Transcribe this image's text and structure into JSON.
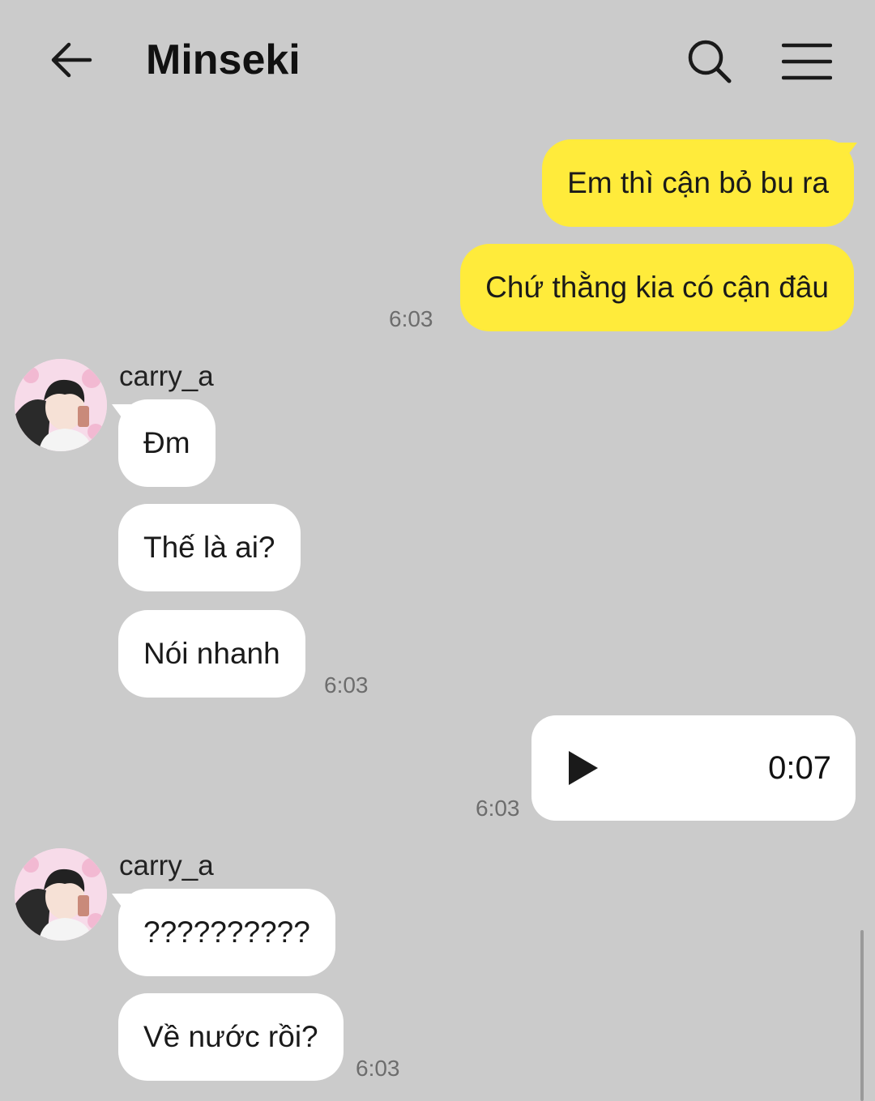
{
  "header": {
    "title": "Minseki",
    "back_icon": "arrow-left-icon",
    "search_icon": "search-icon",
    "menu_icon": "hamburger-menu-icon"
  },
  "colors": {
    "background": "#cbcbcb",
    "outgoing_bubble": "#ffeb3b",
    "incoming_bubble": "#ffffff"
  },
  "messages": {
    "out1": {
      "text": "Em thì cận bỏ bu ra"
    },
    "out2": {
      "text": "Chứ thằng kia có cận đâu",
      "time": "6:03"
    },
    "group1": {
      "sender": "carry_a",
      "msgs": [
        "Đm",
        "Thế là ai?",
        "Nói nhanh"
      ],
      "time": "6:03"
    },
    "voice": {
      "duration": "0:07",
      "time": "6:03",
      "icon": "play-icon"
    },
    "group2": {
      "sender": "carry_a",
      "msgs": [
        "??????????",
        "Về nước rồi?"
      ],
      "time": "6:03"
    }
  }
}
